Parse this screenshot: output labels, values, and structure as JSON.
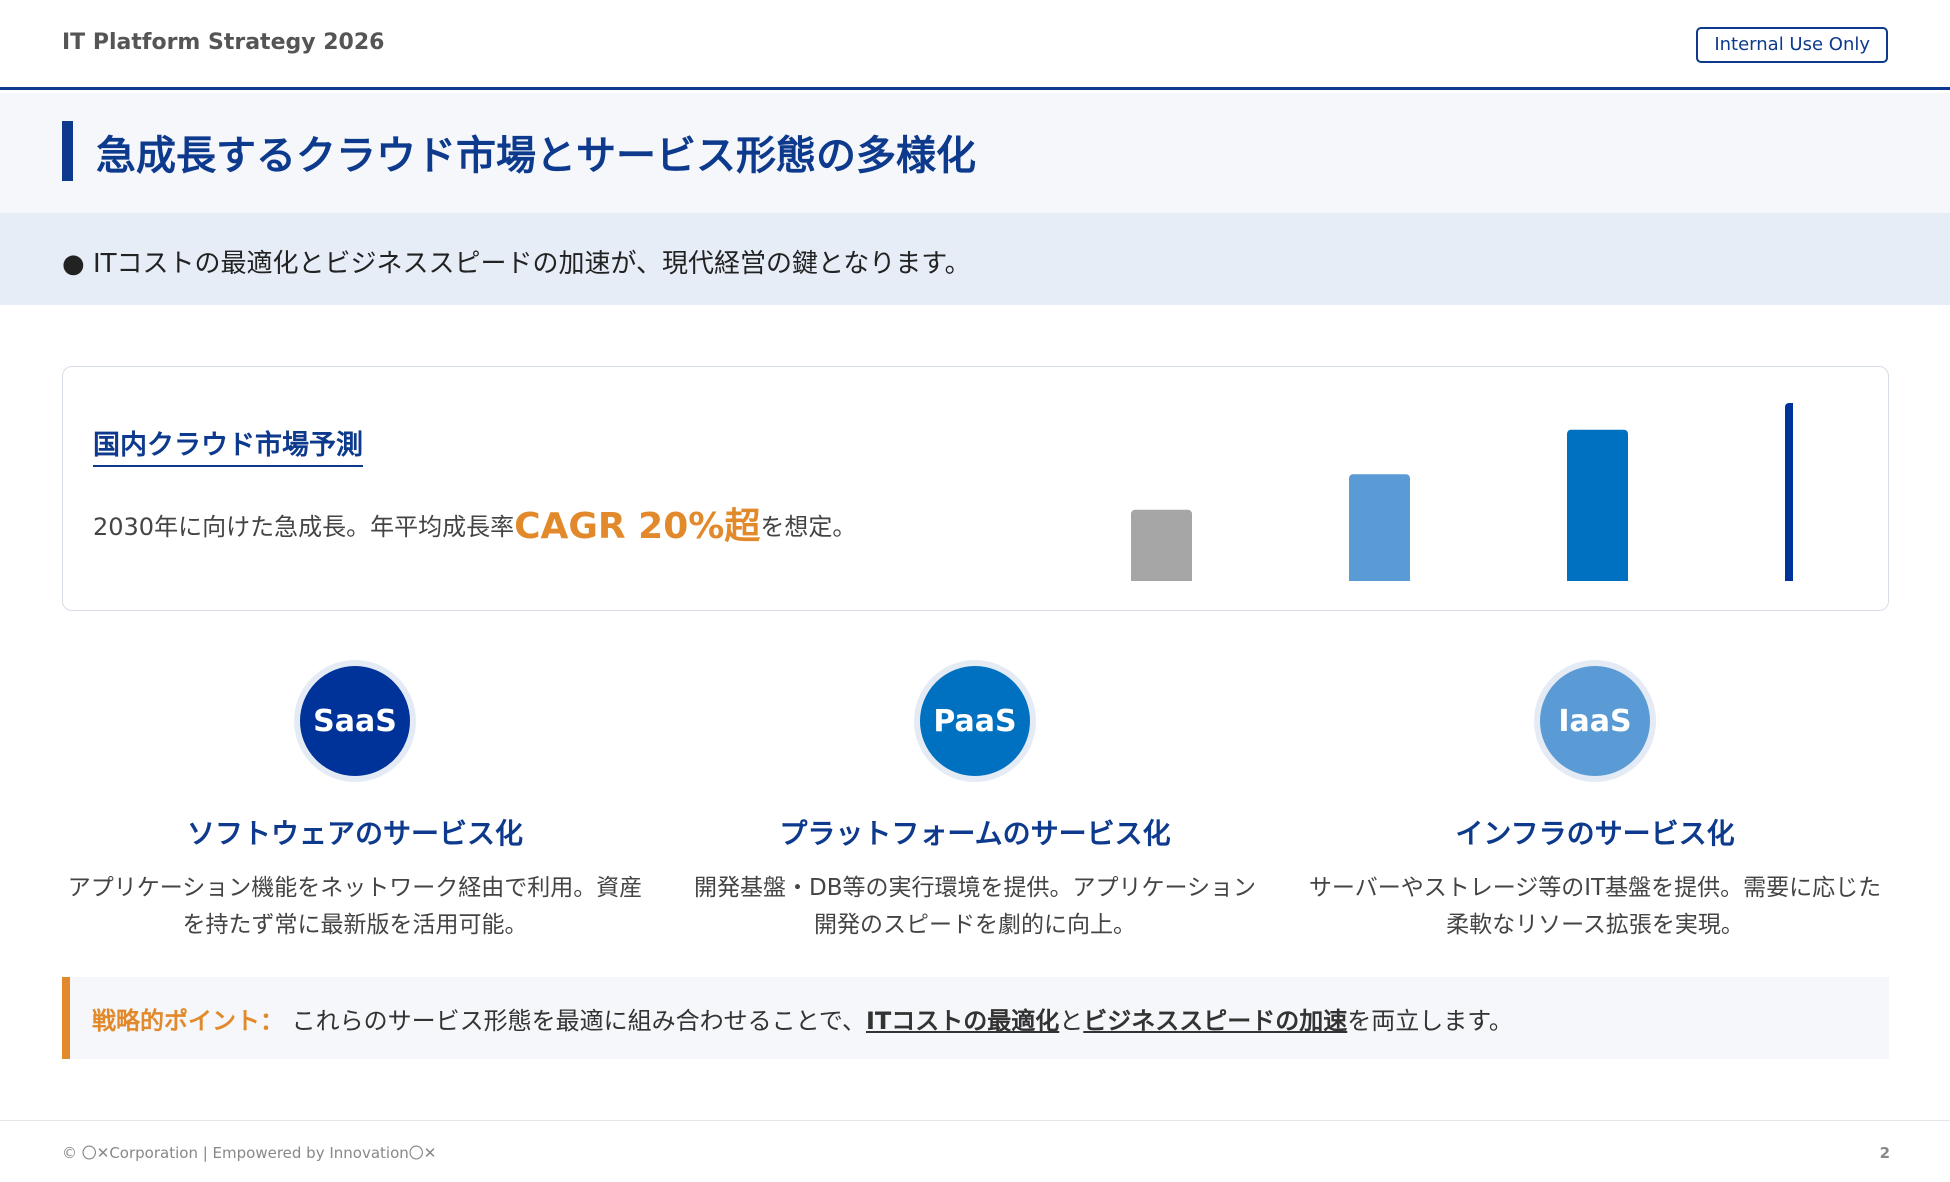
{
  "header": {
    "title": "IT Platform Strategy 2026",
    "badge": "Internal Use Only"
  },
  "slide": {
    "title": "急成長するクラウド市場とサービス形態の多様化",
    "subtitle": "● ITコストの最適化とビジネススピードの加速が、現代経営の鍵となります。"
  },
  "market": {
    "title": "国内クラウド市場予測",
    "desc_before": "2030年に向けた急成長。年平均成長率",
    "desc_highlight": "CAGR 20%超",
    "desc_after": "を想定。"
  },
  "chart_data": {
    "type": "bar",
    "categories": [
      "",
      "",
      "",
      ""
    ],
    "values": [
      0.4,
      0.6,
      0.85,
      1.0
    ],
    "ylim": [
      0,
      1.0
    ],
    "colors": [
      "#a6a6a6",
      "#5b9bd5",
      "#0070c0",
      "#003399"
    ],
    "grid": false,
    "title": "",
    "xlabel": "",
    "ylabel": ""
  },
  "services": [
    {
      "abbr": "SaaS",
      "title": "ソフトウェアのサービス化",
      "desc": "アプリケーション機能をネットワーク経由で利用。資産を持たず常に最新版を活用可能。",
      "color": "#003399"
    },
    {
      "abbr": "PaaS",
      "title": "プラットフォームのサービス化",
      "desc": "開発基盤・DB等の実行環境を提供。アプリケーション開発のスピードを劇的に向上。",
      "color": "#0070c0"
    },
    {
      "abbr": "IaaS",
      "title": "インフラのサービス化",
      "desc": "サーバーやストレージ等のIT基盤を提供。需要に応じた柔軟なリソース拡張を実現。",
      "color": "#5b9bd5"
    }
  ],
  "point": {
    "label": "戦略的ポイント：",
    "text_before": "これらのサービス形態を最適に組み合わせることで、",
    "em1": "ITコストの最適化",
    "mid": "と",
    "em2": "ビジネススピードの加速",
    "text_after": "を両立します。"
  },
  "footer": {
    "left": "© 〇✕Corporation | Empowered by Innovation〇✕",
    "page": "2"
  },
  "colors": {
    "brand": "#0d3a8c",
    "accent": "#e28a2b"
  }
}
